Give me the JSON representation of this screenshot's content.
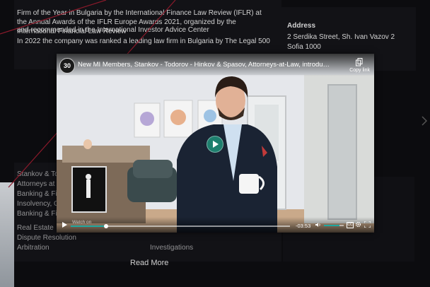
{
  "background": {
    "top_lines": [
      "Firm of the Year in Bulgaria by the International Finance Law Review (IFLR) at the Annual Awards of the IFLR Europe Awards 2021, organized by the International Financial Law Review",
      "and recommended in the International Investor Advice Center",
      "In 2022 the company was ranked a leading law firm in Bulgaria by The Legal 500"
    ],
    "address_label": "Address",
    "address_line1": "2 Serdika Street, Sh. Ivan Vazov 2",
    "address_line2": "Sofia 1000",
    "left_lines": [
      "Stankov & Todorov",
      "Attorneys at Law",
      "Banking & Finance, Corporate/M&A, Tax",
      "Insolvency, Competition",
      "Banking & Finance",
      "Real Estate",
      "Dispute Resolution",
      "Arbitration"
    ],
    "right_small": "Investigations",
    "read_more": "Read More"
  },
  "video": {
    "channel_logo_text": "30",
    "title": "New MI Members, Stankov - Todorov - Hinkov & Spasov, Attorneys-at-Law, introduce their firm...",
    "copy_link_label": "Copy link",
    "watch_label": "Watch on",
    "time_remaining": "-03:53",
    "progress": 0.16,
    "volume": 0.8
  },
  "colors": {
    "accent": "#1fa7a0",
    "play_button": "#1e7f6e",
    "connector_line": "#8b1a2b"
  }
}
